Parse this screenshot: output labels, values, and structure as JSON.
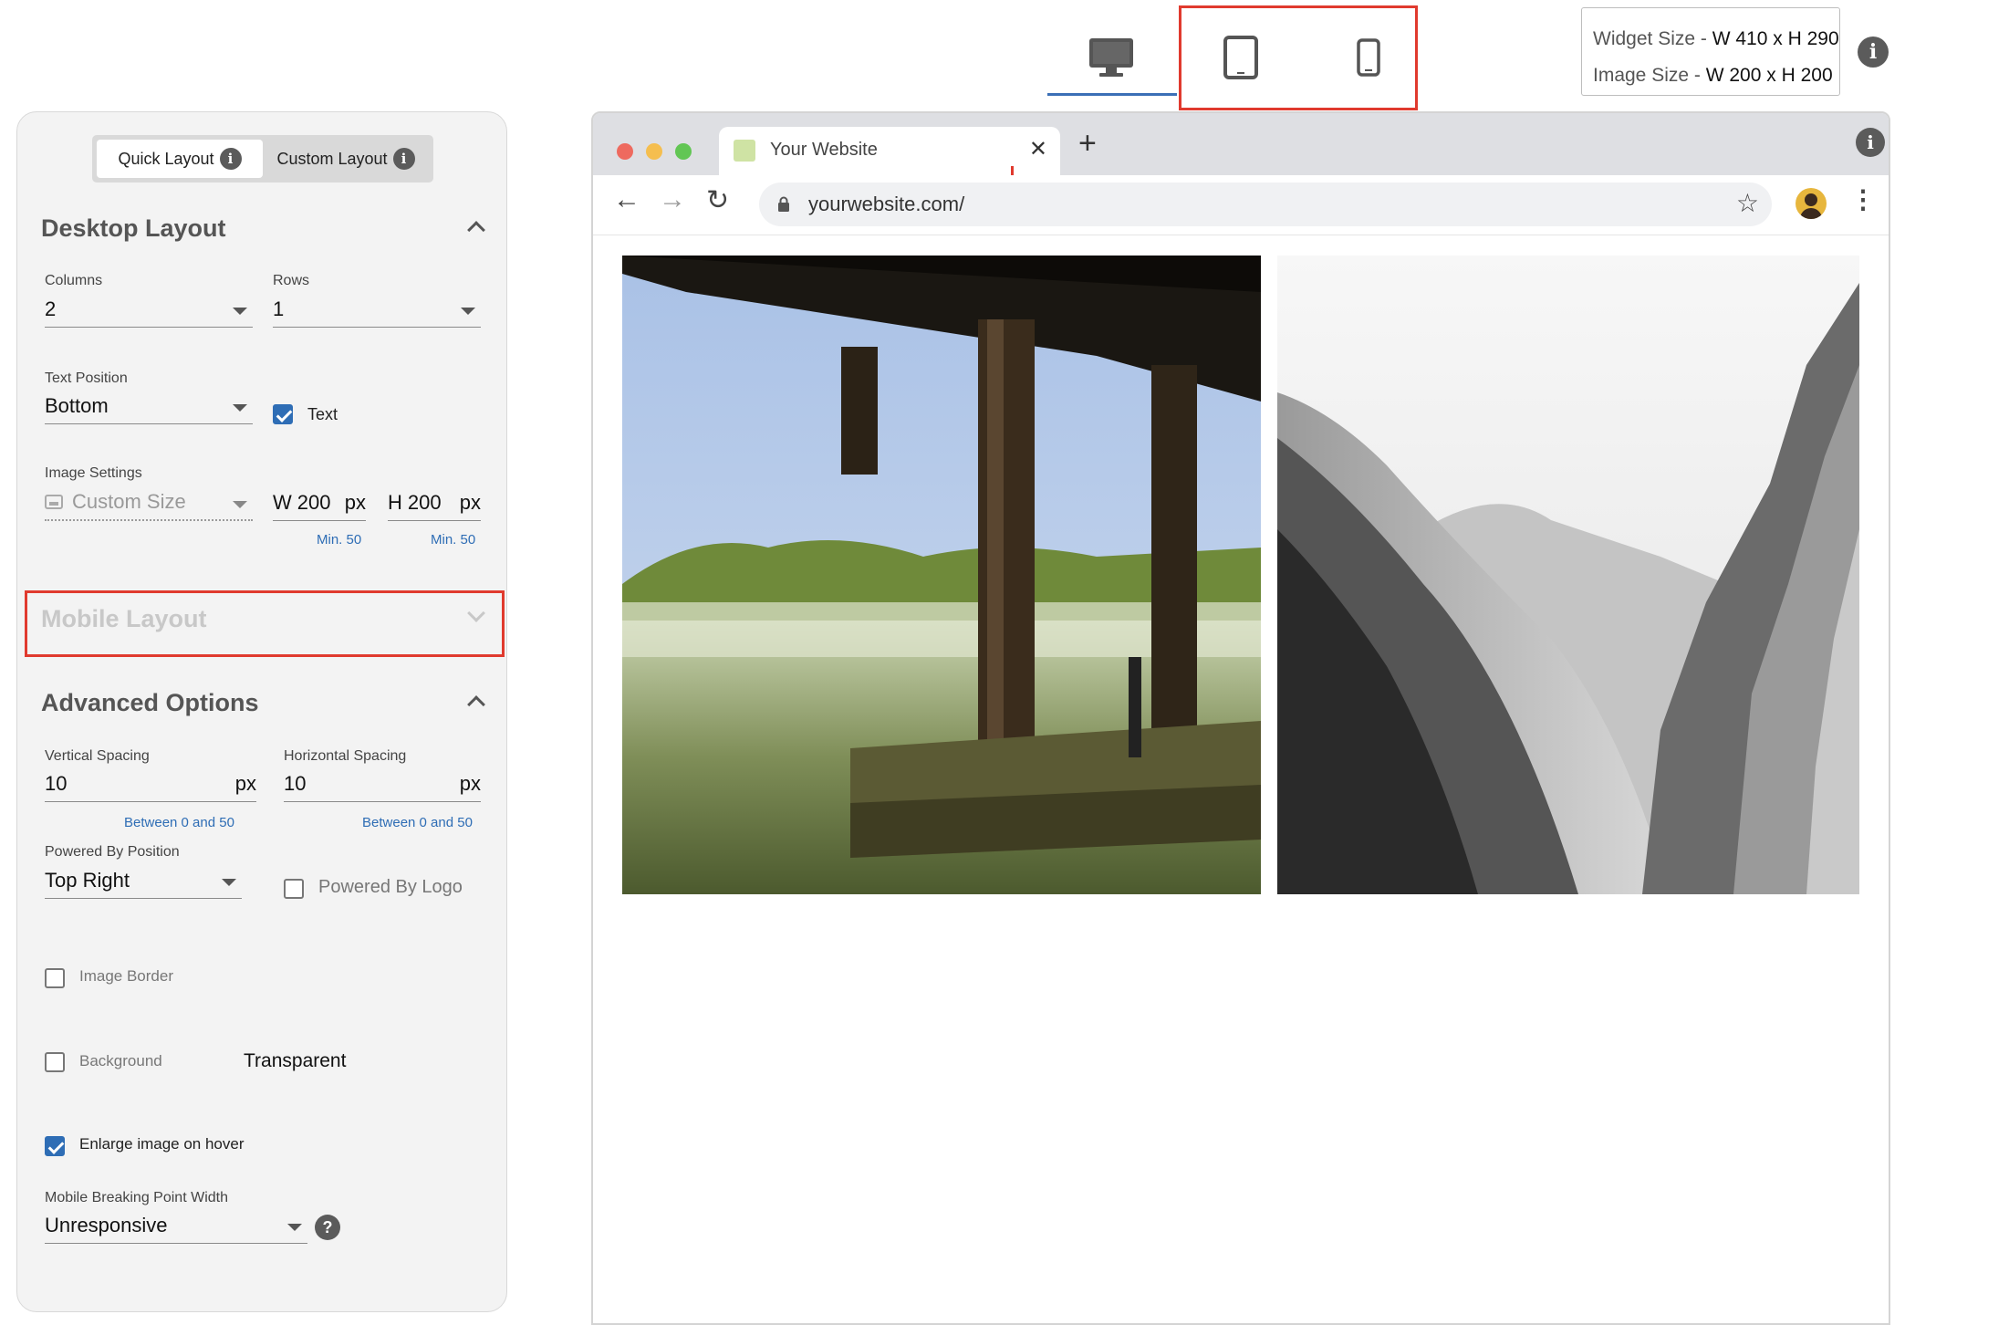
{
  "device_bar": {
    "devices": [
      "desktop-icon",
      "tablet-icon",
      "mobile-icon"
    ],
    "selected": "desktop",
    "widget_size_label": "Widget Size - ",
    "widget_size_value": "W 410 x H 290",
    "image_size_label": "Image Size - ",
    "image_size_value": "W 200 x H 200"
  },
  "layout_toggle": {
    "quick": "Quick Layout",
    "custom": "Custom Layout",
    "active": "quick"
  },
  "desktop_layout": {
    "title": "Desktop Layout",
    "columns_label": "Columns",
    "columns_value": "2",
    "rows_label": "Rows",
    "rows_value": "1",
    "text_position_label": "Text Position",
    "text_position_value": "Bottom",
    "text_checkbox_label": "Text",
    "text_checked": true,
    "image_settings_label": "Image Settings",
    "image_settings_value": "Custom Size",
    "width_prefix": "W",
    "width_value": "200",
    "height_prefix": "H",
    "height_value": "200",
    "unit": "px",
    "width_hint": "Min. 50",
    "height_hint": "Min. 50"
  },
  "mobile_layout": {
    "title": "Mobile Layout"
  },
  "advanced_options": {
    "title": "Advanced Options",
    "vertical_spacing_label": "Vertical Spacing",
    "vertical_spacing_value": "10",
    "horizontal_spacing_label": "Horizontal Spacing",
    "horizontal_spacing_value": "10",
    "unit": "px",
    "vertical_hint": "Between 0 and 50",
    "horizontal_hint": "Between 0 and 50",
    "powered_by_position_label": "Powered By Position",
    "powered_by_position_value": "Top Right",
    "powered_by_logo_label": "Powered By Logo",
    "image_border_label": "Image Border",
    "background_label": "Background",
    "background_value": "Transparent",
    "enlarge_label": "Enlarge image on hover",
    "enlarge_checked": true,
    "breakpoint_label": "Mobile Breaking Point Width",
    "breakpoint_value": "Unresponsive"
  },
  "browser": {
    "tab_title": "Your Website",
    "url": "yourwebsite.com/",
    "colors": {
      "close": "#ee6a5f",
      "minimize": "#f5be4f",
      "maximize": "#62c654"
    }
  },
  "colors": {
    "accent": "#2e6db5",
    "highlight": "#e03a2e"
  }
}
